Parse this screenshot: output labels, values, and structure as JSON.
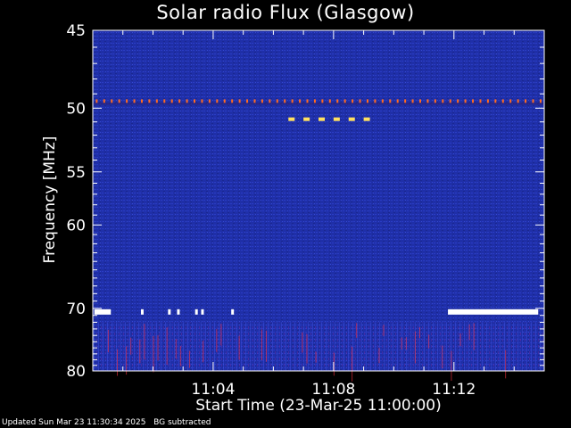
{
  "title": "Solar radio Flux (Glasgow)",
  "footer": {
    "updated": "Updated Sun Mar 23 11:30:34 2025",
    "note": "BG subtracted"
  },
  "colors": {
    "background": "#000000",
    "plot_base": "#1f2fa8",
    "axis": "#ffffff",
    "band_red": "#ff4020",
    "band_yellow": "#ffe060",
    "saturated": "#ffffff"
  },
  "chart_data": {
    "type": "heatmap",
    "title": "Solar radio Flux (Glasgow)",
    "xlabel": "Start Time (23-Mar-25 11:00:00)",
    "ylabel": "Frequency [MHz]",
    "x_unit": "minutes since 11:00",
    "xlim": [
      0,
      15
    ],
    "ylim": [
      45,
      80
    ],
    "y_scale": "reciprocal",
    "grid": false,
    "y_ticks": [
      45,
      50,
      55,
      60,
      70,
      80
    ],
    "y_tick_labels": [
      "45",
      "50",
      "55",
      "60",
      "70",
      "80"
    ],
    "y_minor_ticks": [
      46,
      47,
      48,
      49,
      51,
      52,
      53,
      54,
      56,
      57,
      58,
      59,
      61,
      62,
      63,
      64,
      65,
      66,
      67,
      68,
      69,
      71,
      72,
      73,
      74,
      75,
      76,
      77,
      78,
      79
    ],
    "x_ticks": [
      4,
      8,
      12
    ],
    "x_tick_labels": [
      "11:04",
      "11:08",
      "11:12"
    ],
    "x_minor_ticks": [
      1,
      2,
      3,
      5,
      6,
      7,
      9,
      10,
      11,
      13,
      14
    ],
    "features": [
      {
        "kind": "dotted-line",
        "freq_mhz": 49.5,
        "time_start": 0,
        "time_end": 15,
        "color": "#ff6a20"
      },
      {
        "kind": "dash-segments",
        "freq_mhz": 50.8,
        "time_start": 6.5,
        "time_end": 9.3,
        "color": "#ffe060"
      },
      {
        "kind": "saturated-segment",
        "freq_mhz": 70.5,
        "time_start": 11.8,
        "time_end": 14.8,
        "color": "#ffffff"
      },
      {
        "kind": "saturated-segment",
        "freq_mhz": 70.5,
        "time_start": 0.05,
        "time_end": 0.6,
        "color": "#ffffff"
      },
      {
        "kind": "saturated-blips",
        "freq_mhz": 70.5,
        "times": [
          1.6,
          2.5,
          2.8,
          3.4,
          3.6,
          4.6
        ],
        "color": "#ffffff"
      },
      {
        "kind": "vertical-striation-band",
        "freq_start": 72,
        "freq_end": 80,
        "time_start": 0,
        "time_end": 15,
        "color": "#ff3040"
      }
    ]
  }
}
